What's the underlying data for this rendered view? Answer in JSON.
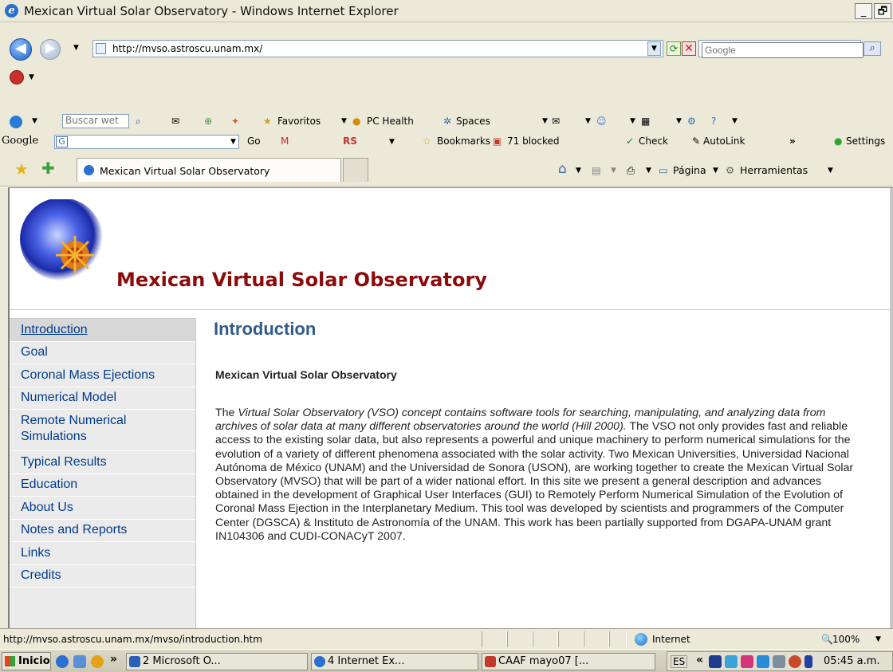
{
  "window": {
    "title": "Mexican Virtual Solar Observatory - Windows Internet Explorer",
    "min_glyph": "_",
    "max_glyph": "🗗"
  },
  "address_bar": {
    "url": "http://mvso.astroscu.unam.mx/",
    "search_placeholder": "Google"
  },
  "toolbar_live": {
    "search_placeholder": "Buscar wet",
    "favorites": "Favoritos",
    "pc_health": "PC Health",
    "spaces": "Spaces"
  },
  "toolbar_google": {
    "logo_g": "Google",
    "go": "Go",
    "rs": "RS",
    "bookmarks": "Bookmarks",
    "blocked": "71 blocked",
    "check": "Check",
    "autolink": "AutoLink",
    "more": "»",
    "settings": "Settings"
  },
  "tabs": {
    "active_tab": "Mexican Virtual Solar Observatory",
    "page_menu": "Página",
    "tools_menu": "Herramientas"
  },
  "page": {
    "site_title": "Mexican Virtual Solar Observatory",
    "heading": "Introduction",
    "subheading": "Mexican Virtual Solar Observatory",
    "para_lead": "The ",
    "para_italic": "Virtual Solar Observatory (VSO) concept contains software tools for searching, manipulating, and analyzing data from archives of solar data at many different observatories around the world (Hill 2000).",
    "para_rest": " The VSO not only provides fast and reliable access to the existing solar data, but also represents a powerful and unique machinery to perform numerical simulations for the evolution of a variety of different phenomena associated with the solar activity. Two Mexican Universities, Universidad Nacional Autónoma de México (UNAM) and the Universidad de Sonora (USON), are working together to create the Mexican Virtual Solar Observatory (MVSO) that will be part of a wider national effort. In this site we present a general description and advances obtained in the development of Graphical User Interfaces (GUI) to Remotely Perform Numerical Simulation of the Evolution of Coronal Mass Ejection in the Interplanetary Medium. This tool was developed by scientists and programmers of the Computer Center (DGSCA) & Instituto de Astronomía of the UNAM. This work has been partially supported from DGAPA-UNAM grant IN104306 and CUDI-CONACyT 2007."
  },
  "sidebar": {
    "items": [
      {
        "label": "Introduction",
        "selected": true
      },
      {
        "label": "Goal"
      },
      {
        "label": "Coronal Mass Ejections"
      },
      {
        "label": "Numerical Model"
      },
      {
        "label": "Remote Numerical Simulations"
      },
      {
        "label": "Typical Results"
      },
      {
        "label": "Education"
      },
      {
        "label": "About Us"
      },
      {
        "label": "Notes and Reports"
      },
      {
        "label": "Links"
      },
      {
        "label": "Credits"
      }
    ]
  },
  "status_bar": {
    "url": "http://mvso.astroscu.unam.mx/mvso/introduction.htm",
    "zone": "Internet",
    "zoom": "100%"
  },
  "taskbar": {
    "start": "Inicio",
    "more": "»",
    "tasks": [
      {
        "label": "2 Microsoft O...",
        "color": "#2b5fb8"
      },
      {
        "label": "4 Internet Ex...",
        "color": "#2b6fd0"
      },
      {
        "label": "CAAF mayo07 [...",
        "color": "#c0392b"
      }
    ],
    "lang": "ES",
    "tray_more": "«",
    "clock": "05:45 a.m."
  },
  "colors": {
    "site_title": "#8b0a0a",
    "heading": "#2f5b8a",
    "nav_link": "#003b8e",
    "chrome": "#ece9d8"
  }
}
